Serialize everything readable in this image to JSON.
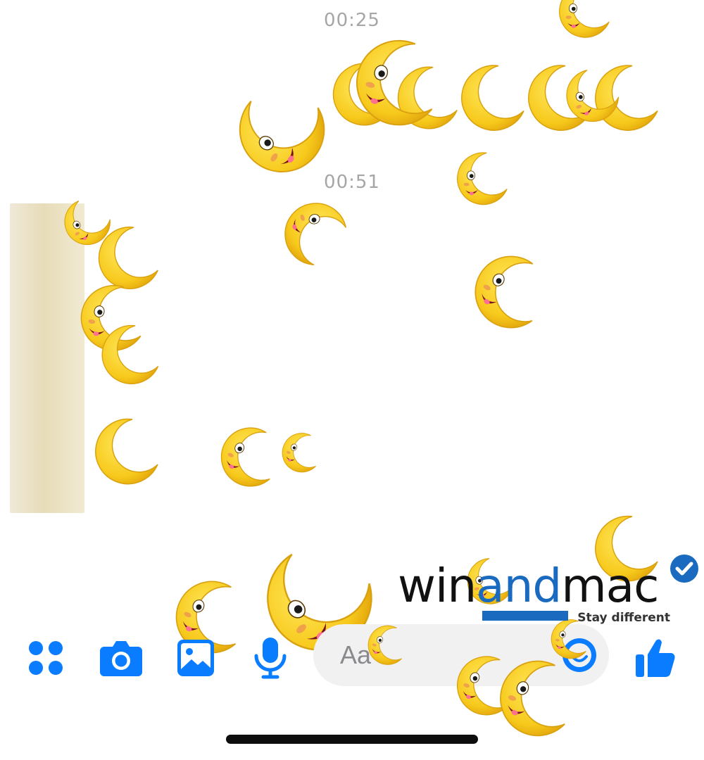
{
  "conversation": {
    "timestamps": [
      "00:25",
      "00:51"
    ]
  },
  "effect": {
    "name": "crescent-moon-emoji-rain"
  },
  "composer": {
    "placeholder": "Aa",
    "icons": [
      "apps-icon",
      "camera-icon",
      "photo-icon",
      "microphone-icon",
      "emoji-icon",
      "thumbs-up-icon"
    ],
    "accent_color": "#0a7cff"
  },
  "watermark": {
    "prefix": "win",
    "highlight": "and",
    "suffix": "mac",
    "tagline": "Stay different",
    "brand_color": "#1a6bbf"
  }
}
